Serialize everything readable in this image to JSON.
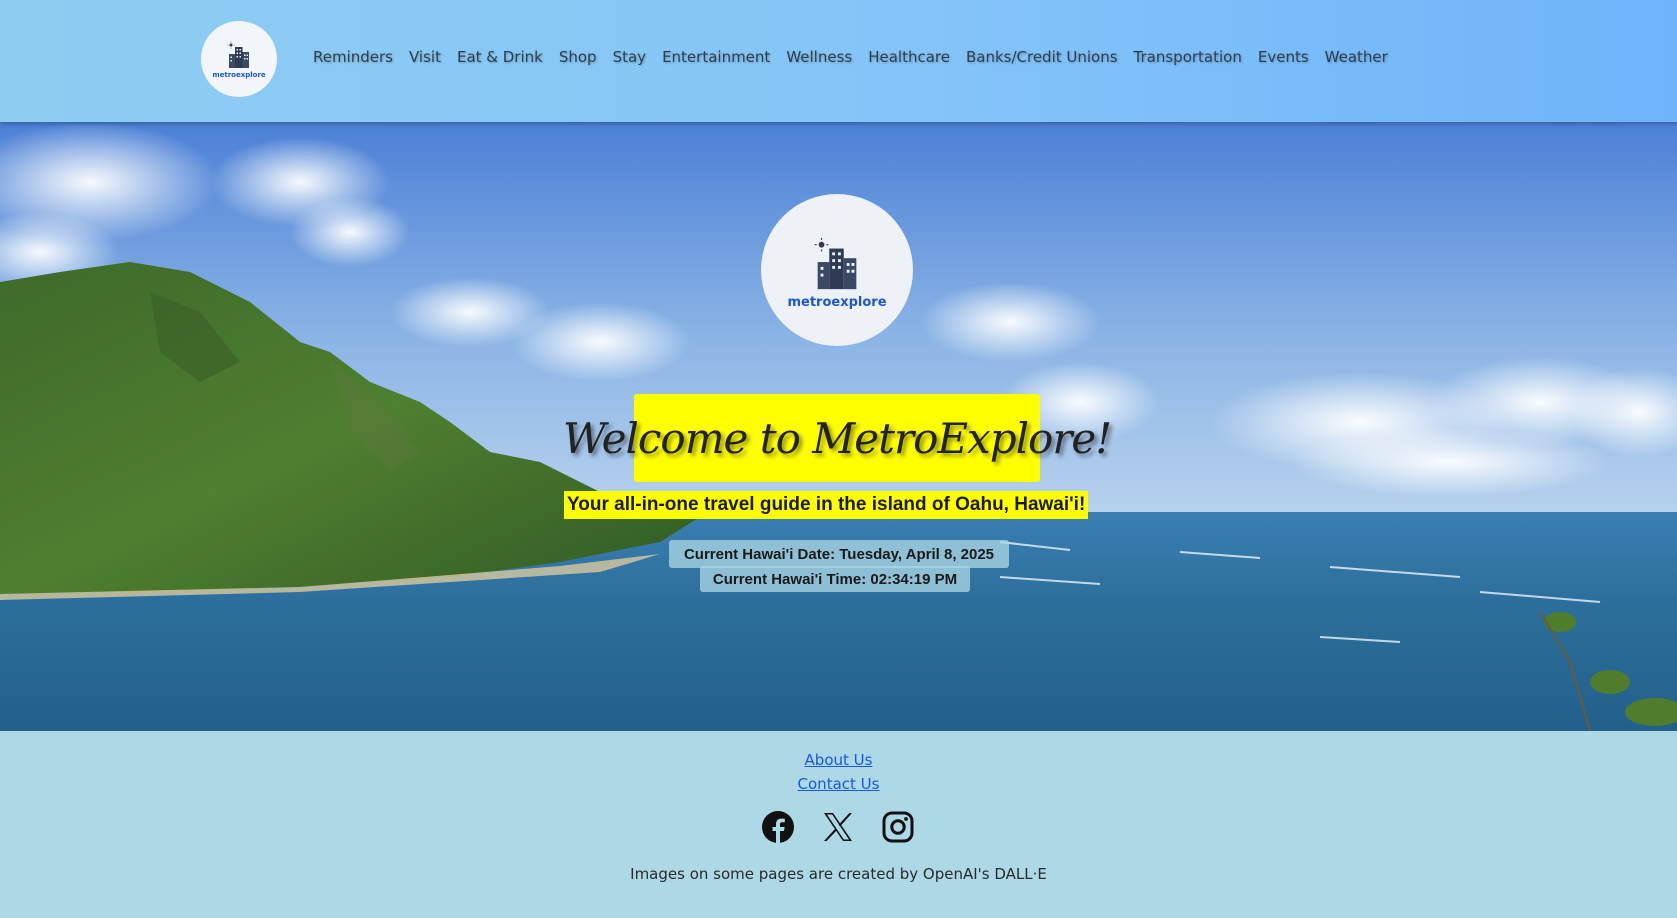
{
  "header": {
    "logo_text": "metroexplore",
    "nav": [
      "Reminders",
      "Visit",
      "Eat & Drink",
      "Shop",
      "Stay",
      "Entertainment",
      "Wellness",
      "Healthcare",
      "Banks/Credit Unions",
      "Transportation",
      "Events",
      "Weather"
    ]
  },
  "hero": {
    "logo_text": "metroexplore",
    "welcome": "Welcome to MetroExplore!",
    "tagline": "Your all-in-one travel guide in the island of Oahu, Hawai'i!",
    "date_line": "Current Hawai'i Date: Tuesday, April 8, 2025",
    "time_line": "Current Hawai'i Time: 02:34:19 PM"
  },
  "footer": {
    "about_label": "About Us",
    "contact_label": "Contact Us",
    "socials": [
      "facebook-icon",
      "x-icon",
      "instagram-icon"
    ],
    "credit": "Images on some pages are created by OpenAI's DALL·E"
  },
  "colors": {
    "header_start": "#8ecdf1",
    "header_end": "#6fb4fb",
    "footer_bg": "#add8e6",
    "highlight": "#ffff00",
    "logo_text": "#1f56d6",
    "link": "#1a57e0"
  }
}
